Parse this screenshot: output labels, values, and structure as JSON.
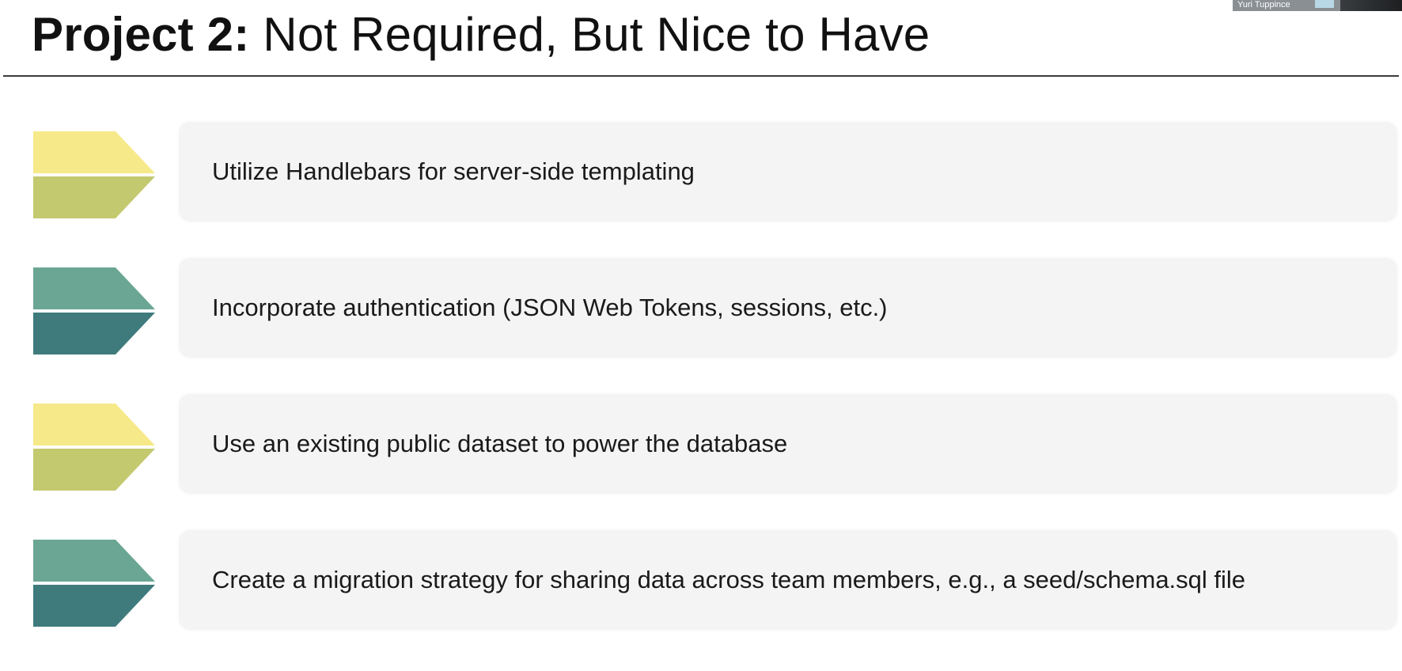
{
  "slide": {
    "title_bold": "Project 2:",
    "title_rest": " Not Required, But Nice to Have"
  },
  "speaker": {
    "name": "Yuri Tuppince"
  },
  "items": [
    {
      "text": "Utilize Handlebars for server-side templating",
      "icon": "chevron-arrow-icon",
      "top_color": "#f6e98a",
      "bottom_color": "#c3c96e"
    },
    {
      "text": "Incorporate authentication (JSON Web Tokens, sessions, etc.)",
      "icon": "chevron-arrow-icon",
      "top_color": "#6aa693",
      "bottom_color": "#3f7b7c"
    },
    {
      "text": "Use an existing public dataset to power the database",
      "icon": "chevron-arrow-icon",
      "top_color": "#f6e98a",
      "bottom_color": "#c3c96e"
    },
    {
      "text": "Create a migration strategy for sharing data across team members, e.g., a seed/schema.sql file",
      "icon": "chevron-arrow-icon",
      "top_color": "#6aa693",
      "bottom_color": "#3f7b7c"
    }
  ]
}
